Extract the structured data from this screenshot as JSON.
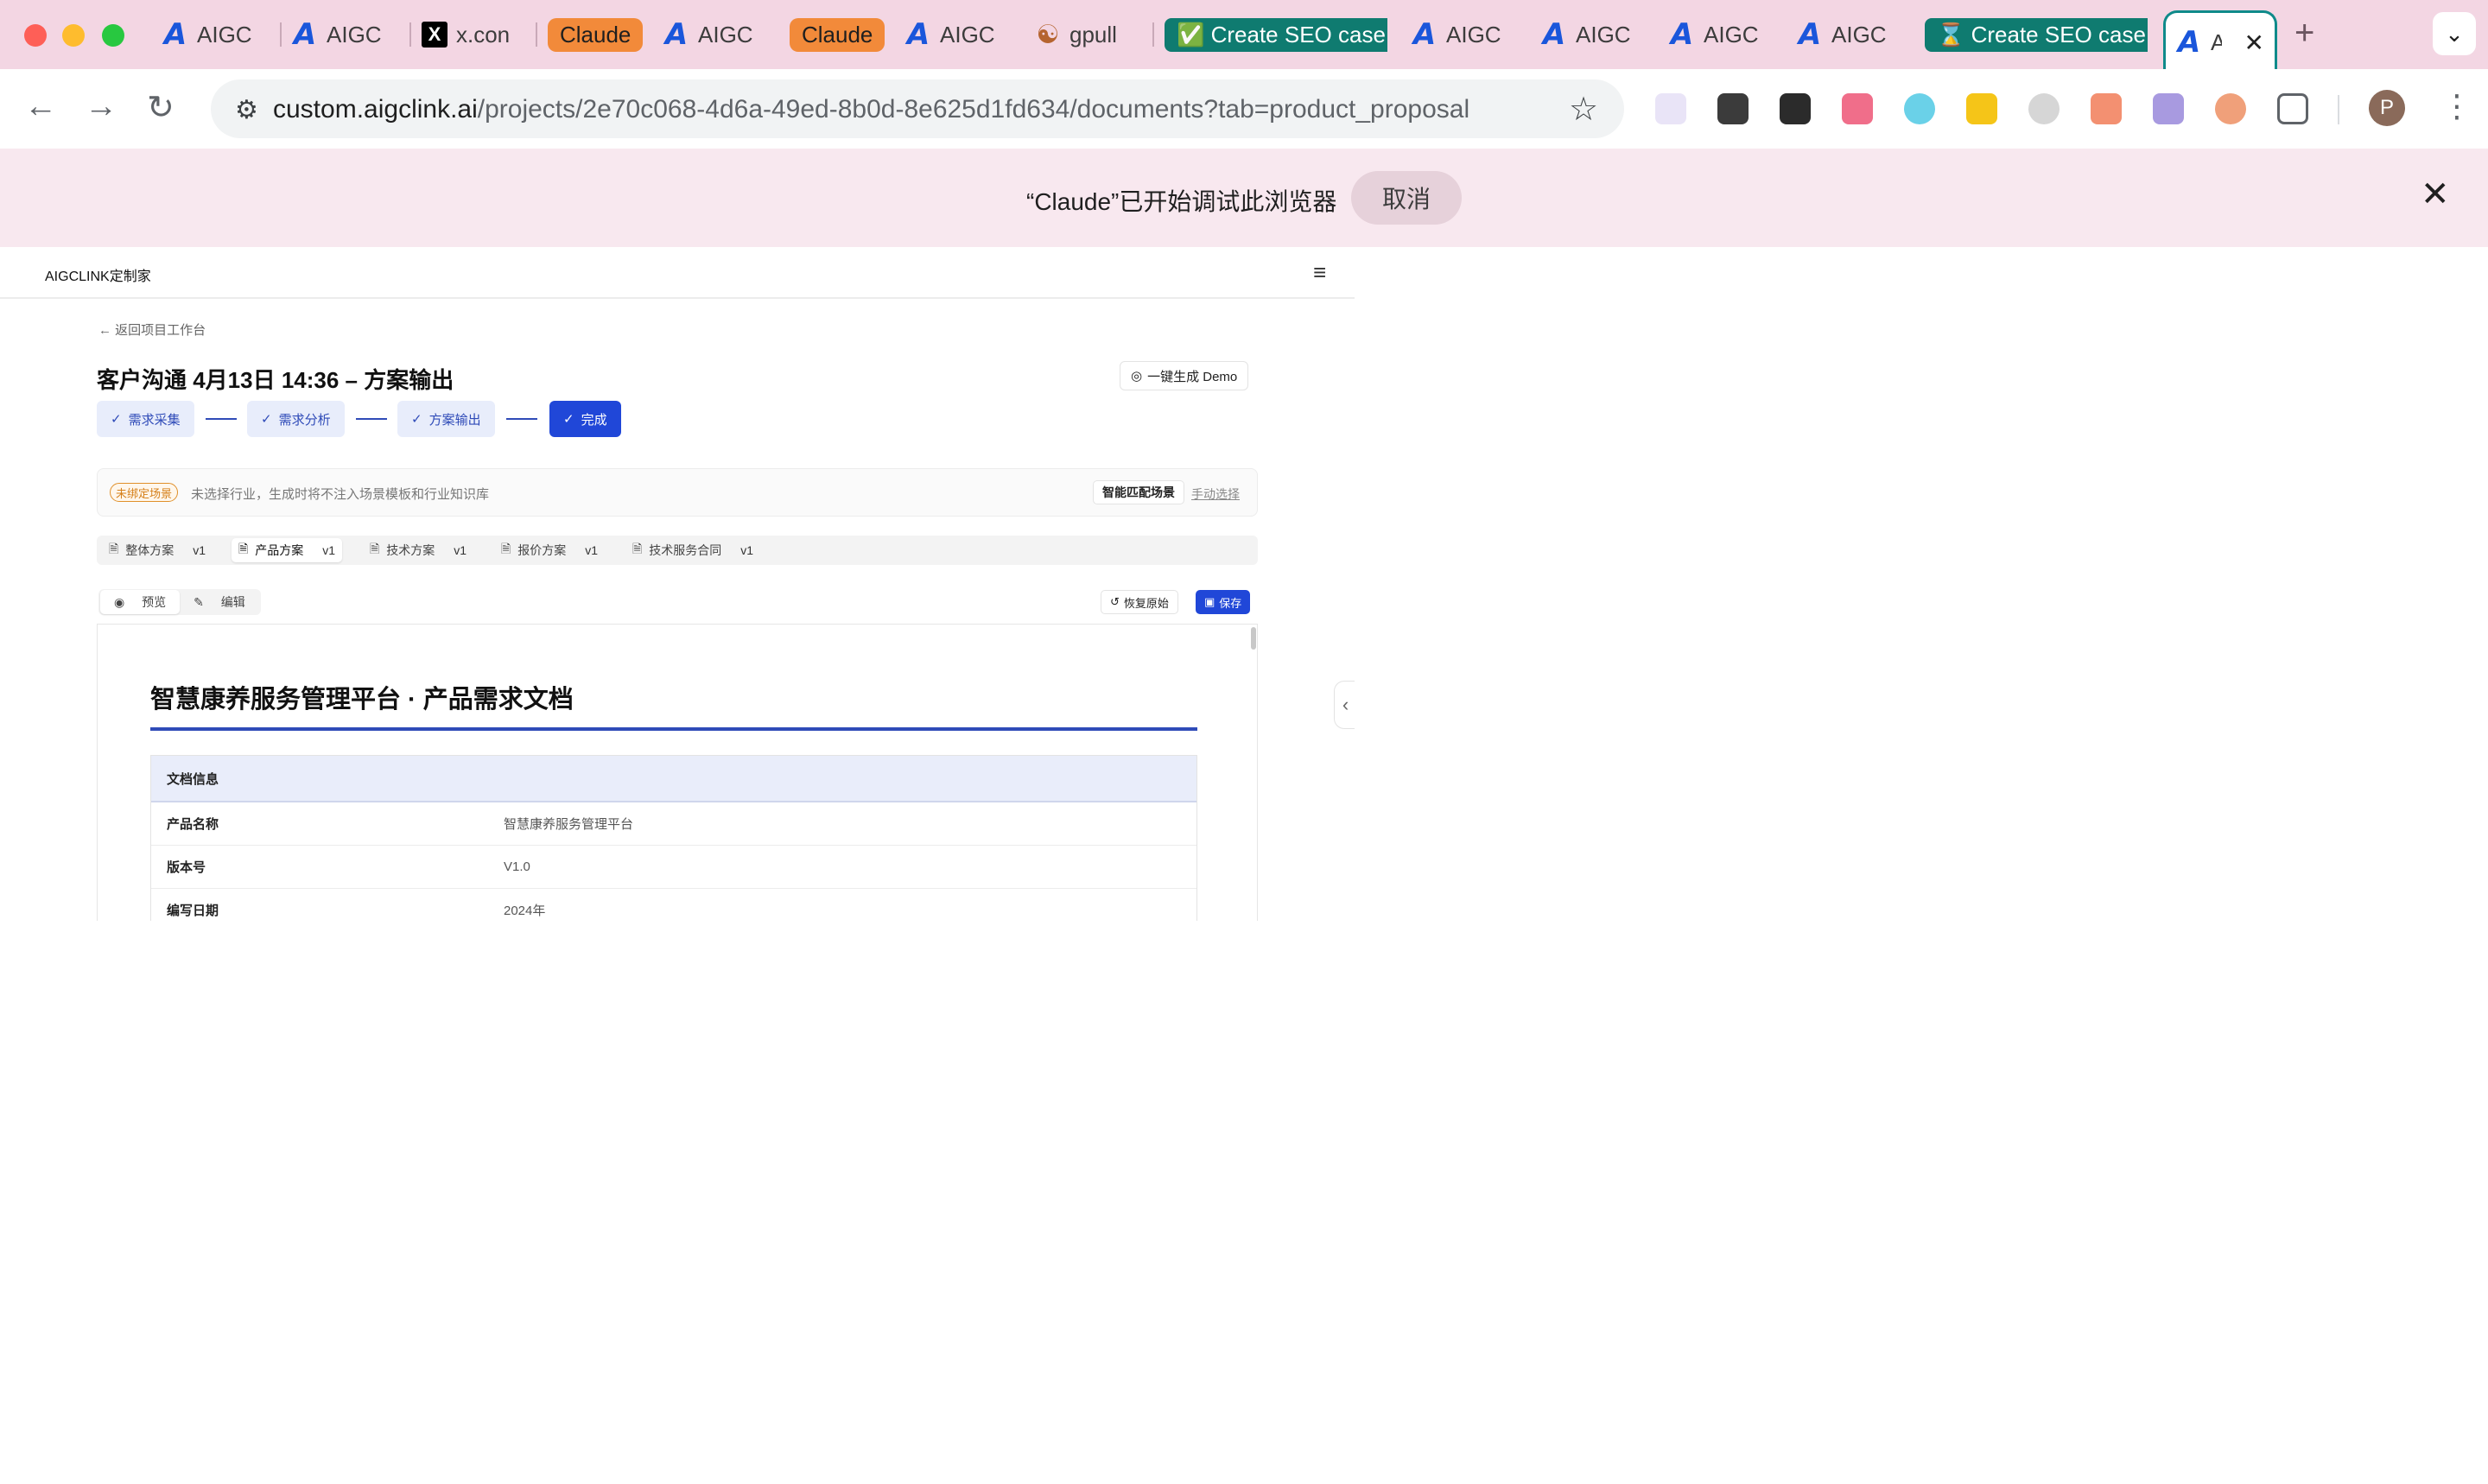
{
  "browser": {
    "tabs": [
      {
        "title": "AIGC",
        "favicon": "aigclink-a-icon"
      },
      {
        "title": "AIGC",
        "favicon": "aigclink-a-icon"
      },
      {
        "title": "x.con",
        "favicon": "x-icon"
      },
      {
        "title": "Claude",
        "favicon": "none"
      },
      {
        "title": "AIGC",
        "favicon": "aigclink-a-icon"
      },
      {
        "title": "Claude",
        "favicon": "none"
      },
      {
        "title": "AIGC",
        "favicon": "aigclink-a-icon"
      },
      {
        "title": "gpull",
        "favicon": "gitee-icon"
      },
      {
        "title": "✅ Create SEO case s",
        "favicon": "none"
      },
      {
        "title": "AIGC",
        "favicon": "aigclink-a-icon"
      },
      {
        "title": "AIGC",
        "favicon": "aigclink-a-icon"
      },
      {
        "title": "AIGC",
        "favicon": "aigclink-a-icon"
      },
      {
        "title": "AIGC",
        "favicon": "aigclink-a-icon"
      },
      {
        "title": "⌛ Create SEO case s",
        "favicon": "none"
      },
      {
        "title": "A",
        "favicon": "aigclink-a-icon"
      }
    ],
    "url_host": "custom.aigclink.ai",
    "url_path": "/projects/2e70c068-4d6a-49ed-8b0d-8e625d1fd634/documents?tab=product_proposal",
    "profile_initial": "P",
    "debug_message": "“Claude”已开始调试此浏览器",
    "debug_cancel": "取消",
    "colors": {
      "tabstrip": "#f3d6e3",
      "claude_tab": "#f28a3a",
      "seo_tab": "#0f7b70",
      "active_border": "#0f8a8a"
    }
  },
  "app": {
    "brand": "AIGCLINK定制家",
    "back_link": "返回项目工作台",
    "doc_title": "客户沟通 4月13日 14:36 – 方案输出",
    "demo_button": "一键生成 Demo",
    "steps": [
      "需求采集",
      "需求分析",
      "方案输出",
      "完成"
    ],
    "scene": {
      "tag": "未绑定场景",
      "hint": "未选择行业，生成时将不注入场景模板和行业知识库",
      "smart_button": "智能匹配场景",
      "manual_link": "手动选择"
    },
    "doc_tabs": [
      {
        "label": "整体方案",
        "version": "v1"
      },
      {
        "label": "产品方案",
        "version": "v1"
      },
      {
        "label": "技术方案",
        "version": "v1"
      },
      {
        "label": "报价方案",
        "version": "v1"
      },
      {
        "label": "技术服务合同",
        "version": "v1"
      }
    ],
    "mode": {
      "preview": "预览",
      "edit": "编辑"
    },
    "restore_button": "恢复原始",
    "save_button": "保存",
    "document": {
      "title": "智慧康养服务管理平台 · 产品需求文档",
      "info_header": "文档信息",
      "rows": [
        {
          "key": "产品名称",
          "value": "智慧康养服务管理平台"
        },
        {
          "key": "版本号",
          "value": "V1.0"
        },
        {
          "key": "编写日期",
          "value": "2024年"
        }
      ]
    },
    "colors": {
      "primary": "#2047d8",
      "step_bg": "#e8edfb",
      "tag_orange": "#e0902a"
    }
  }
}
